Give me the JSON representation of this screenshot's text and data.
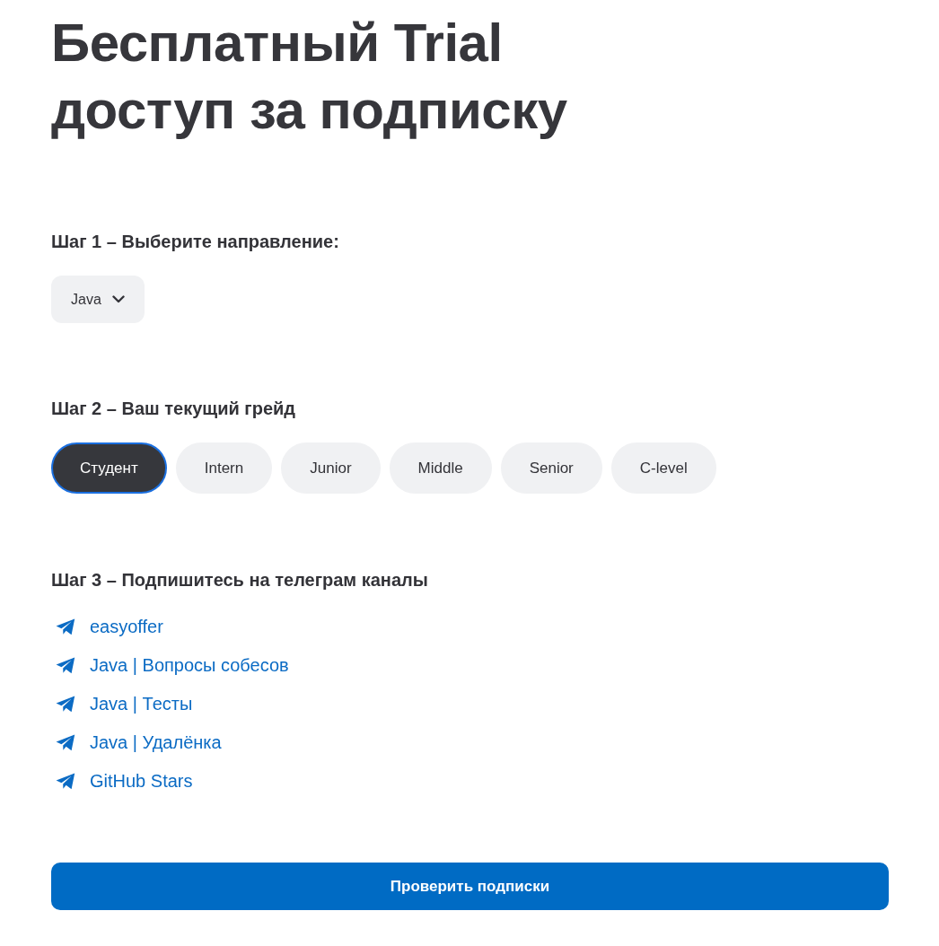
{
  "title": "Бесплатный Trial доступ за подписку",
  "step_1": {
    "heading": "Шаг 1 – Выберите направление:",
    "dropdown": {
      "value": "Java"
    }
  },
  "step_2": {
    "heading": "Шаг 2 – Ваш текущий грейд",
    "grades": [
      {
        "label": "Студент",
        "selected": true
      },
      {
        "label": "Intern",
        "selected": false
      },
      {
        "label": "Junior",
        "selected": false
      },
      {
        "label": "Middle",
        "selected": false
      },
      {
        "label": "Senior",
        "selected": false
      },
      {
        "label": "C-level",
        "selected": false
      }
    ]
  },
  "step_3": {
    "heading": "Шаг 3 – Подпишитесь на телеграм каналы",
    "channels": [
      {
        "label": "easyoffer"
      },
      {
        "label": "Java | Вопросы собесов"
      },
      {
        "label": "Java | Тесты"
      },
      {
        "label": "Java | Удалёнка"
      },
      {
        "label": "GitHub Stars"
      }
    ]
  },
  "submit_button": {
    "label": "Проверить подписки"
  }
}
